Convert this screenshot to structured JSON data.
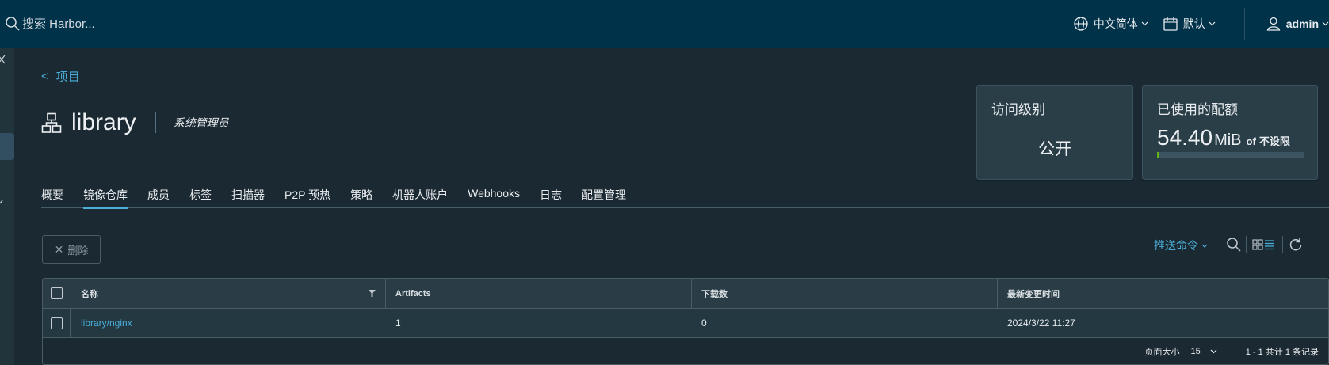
{
  "header": {
    "search_placeholder": "搜索 Harbor...",
    "language": "中文简体",
    "theme": "默认",
    "user": "admin"
  },
  "breadcrumb": {
    "back_label": "<",
    "label": "项目"
  },
  "project": {
    "name": "library",
    "role": "系统管理员"
  },
  "cards": {
    "access_title": "访问级别",
    "access_value": "公开",
    "quota_title": "已使用的配额",
    "quota_value": "54.40",
    "quota_unit": "MiB",
    "quota_of": "of",
    "quota_limit": "不设限"
  },
  "tabs": [
    {
      "label": "概要",
      "active": false
    },
    {
      "label": "镜像仓库",
      "active": true
    },
    {
      "label": "成员",
      "active": false
    },
    {
      "label": "标签",
      "active": false
    },
    {
      "label": "扫描器",
      "active": false
    },
    {
      "label": "P2P 预热",
      "active": false
    },
    {
      "label": "策略",
      "active": false
    },
    {
      "label": "机器人账户",
      "active": false
    },
    {
      "label": "Webhooks",
      "active": false
    },
    {
      "label": "日志",
      "active": false
    },
    {
      "label": "配置管理",
      "active": false
    }
  ],
  "toolbar": {
    "delete_label": "删除",
    "push_command": "推送命令"
  },
  "table": {
    "columns": [
      "名称",
      "Artifacts",
      "下载数",
      "最新变更时间"
    ],
    "rows": [
      {
        "name": "library/nginx",
        "artifacts": "1",
        "downloads": "0",
        "updated": "2024/3/22 11:27"
      }
    ]
  },
  "pagination": {
    "page_size_label": "页面大小",
    "page_size": "15",
    "summary": "1 - 1 共计 1 条记录"
  },
  "colors": {
    "header_bg": "#00324a",
    "page_bg": "#1b2a32",
    "accent": "#4aaed9"
  }
}
